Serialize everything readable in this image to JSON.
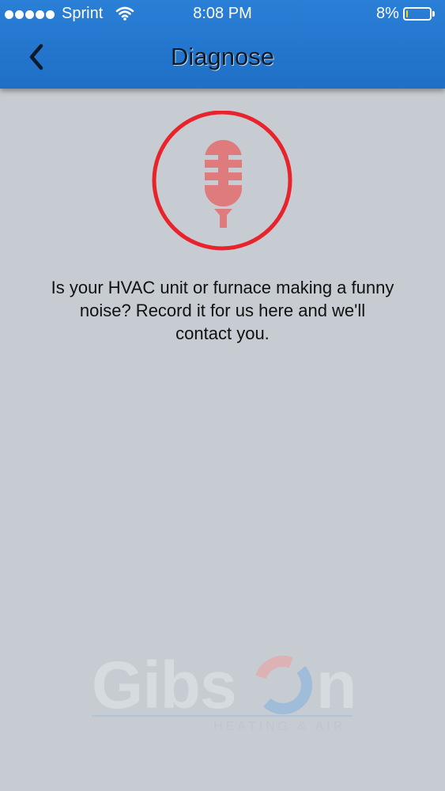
{
  "status_bar": {
    "carrier": "Sprint",
    "time": "8:08 PM",
    "battery_percent": "8%",
    "battery_level": 0.08,
    "icons": [
      "signal-dots-icon",
      "wifi-icon",
      "battery-icon"
    ]
  },
  "nav": {
    "title": "Diagnose",
    "back_icon": "chevron-left-icon"
  },
  "main": {
    "record_icon": "microphone-icon",
    "prompt_line1": "Is your HVAC unit or furnace making a funny",
    "prompt_line2": "noise?  Record it for us here and we'll",
    "prompt_line3": "contact you."
  },
  "logo": {
    "wordmark_left": "Gibs",
    "wordmark_right": "n",
    "tagline": "HEATING & AIR"
  },
  "colors": {
    "nav_blue": "#2179d2",
    "background": "#c6ccd1",
    "record_red": "#e8232b",
    "mic_pink": "#e07b7d"
  }
}
